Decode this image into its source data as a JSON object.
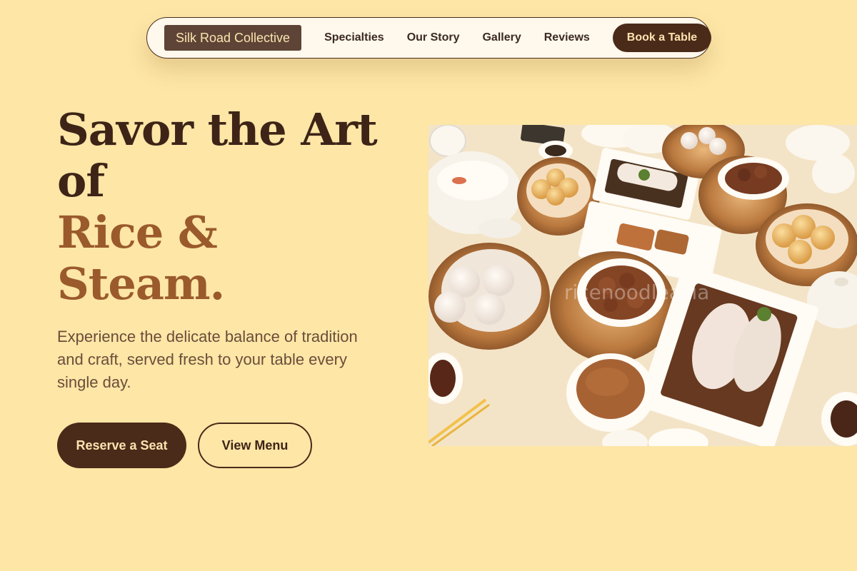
{
  "nav": {
    "brand": "Silk Road Collective",
    "links": [
      "Specialties",
      "Our Story",
      "Gallery",
      "Reviews"
    ],
    "cta": "Book a Table"
  },
  "hero": {
    "title_line1": "Savor the Art of",
    "title_line2": "Rice &",
    "title_line3": "Steam.",
    "subtitle": "Experience the delicate balance of tradition and craft, served fresh to your table every single day.",
    "primary_button": "Reserve a Seat",
    "secondary_button": "View Menu",
    "image_watermark": "ricenoodleasia"
  },
  "colors": {
    "background": "#fde6a6",
    "dark_brown": "#4a2a18",
    "accent_brown": "#9a5a2c",
    "brand_bg": "#5e4436"
  }
}
